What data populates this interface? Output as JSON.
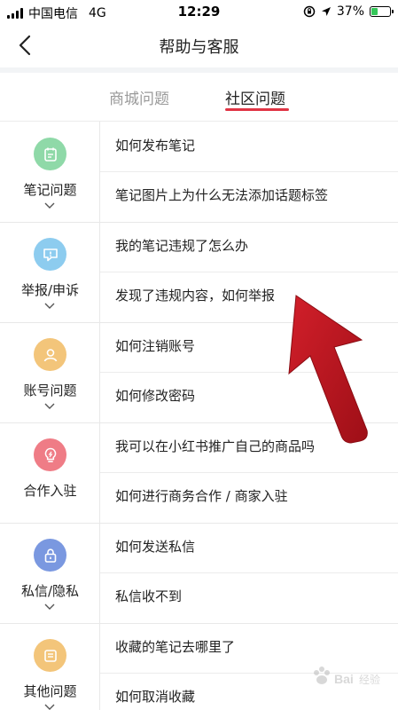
{
  "status_bar": {
    "carrier": "中国电信",
    "network": "4G",
    "time": "12:29",
    "battery": "37%",
    "battery_level": 0.37
  },
  "header": {
    "title": "帮助与客服"
  },
  "tabs": [
    {
      "label": "商城问题",
      "selected": false
    },
    {
      "label": "社区问题",
      "selected": true
    }
  ],
  "categories": [
    {
      "name": "笔记问题",
      "icon": "note-icon",
      "color": "#8fd9a8",
      "questions": [
        "如何发布笔记",
        "笔记图片上为什么无法添加话题标签"
      ]
    },
    {
      "name": "举报/申诉",
      "icon": "report-icon",
      "color": "#8dccef",
      "questions": [
        "我的笔记违规了怎么办",
        "发现了违规内容，如何举报"
      ]
    },
    {
      "name": "账号问题",
      "icon": "account-icon",
      "color": "#f3c57a",
      "questions": [
        "如何注销账号",
        "如何修改密码"
      ]
    },
    {
      "name": "合作入驻",
      "icon": "bulb-icon",
      "color": "#ef7c86",
      "questions": [
        "我可以在小红书推广自己的商品吗",
        "如何进行商务合作 / 商家入驻"
      ]
    },
    {
      "name": "私信/隐私",
      "icon": "lock-icon",
      "color": "#7a98e0",
      "questions": [
        "如何发送私信",
        "私信收不到"
      ]
    },
    {
      "name": "其他问题",
      "icon": "other-icon",
      "color": "#f3c57a",
      "questions": [
        "收藏的笔记去哪里了",
        "如何取消收藏"
      ]
    }
  ],
  "colors": {
    "accent": "#e03444",
    "annotation_arrow": "#b5121b"
  }
}
